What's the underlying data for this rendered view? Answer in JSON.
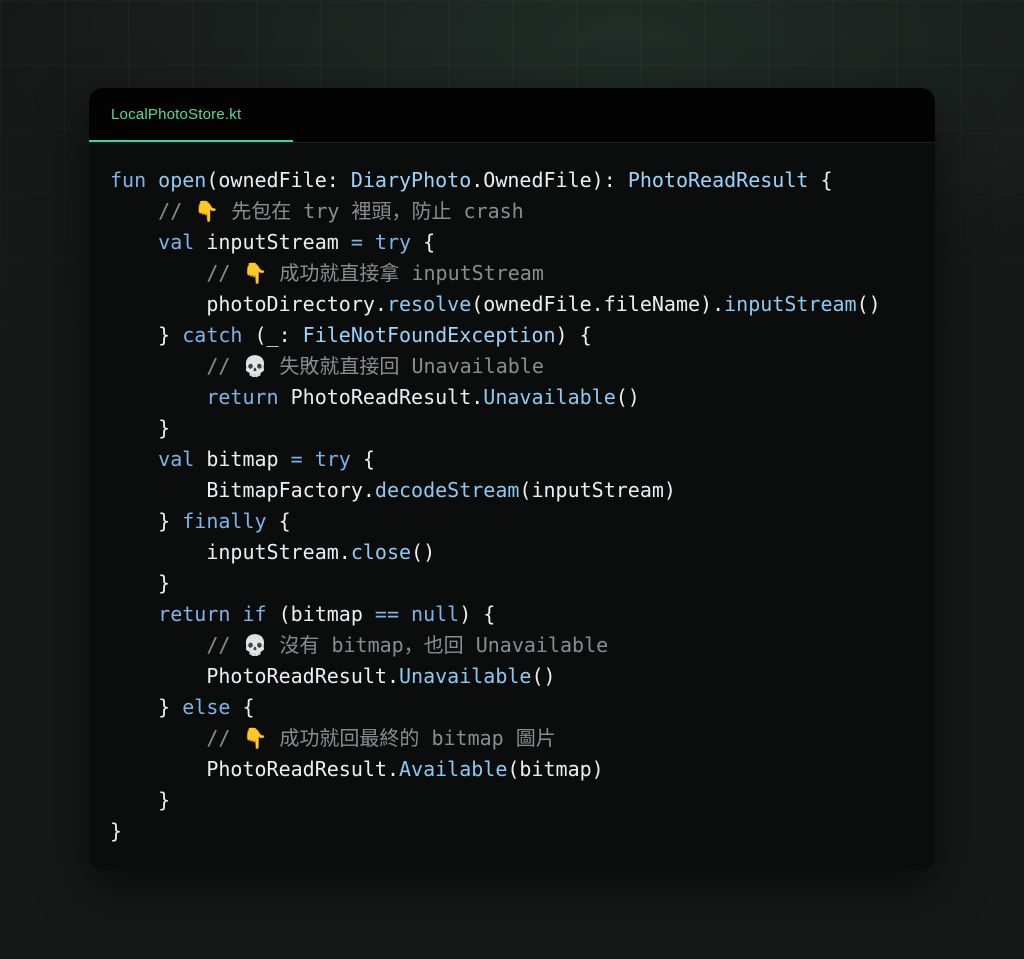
{
  "editor": {
    "tab_label": "LocalPhotoStore.kt",
    "lines": [
      [
        [
          "kw",
          "fun "
        ],
        [
          "fn",
          "open"
        ],
        [
          "pl",
          "(ownedFile: "
        ],
        [
          "ty",
          "DiaryPhoto"
        ],
        [
          "pl",
          ".OwnedFile): "
        ],
        [
          "ty",
          "PhotoReadResult"
        ],
        [
          "pl",
          " {"
        ]
      ],
      [
        [
          "pl",
          "    "
        ],
        [
          "cm",
          "// "
        ],
        [
          "em",
          "👇"
        ],
        [
          "cm",
          " 先包在 try 裡頭，防止 crash"
        ]
      ],
      [
        [
          "pl",
          "    "
        ],
        [
          "kw",
          "val "
        ],
        [
          "pl",
          "inputStream "
        ],
        [
          "kw",
          "= try "
        ],
        [
          "pl",
          "{"
        ]
      ],
      [
        [
          "pl",
          "        "
        ],
        [
          "cm",
          "// "
        ],
        [
          "em",
          "👇"
        ],
        [
          "cm",
          " 成功就直接拿 inputStream"
        ]
      ],
      [
        [
          "pl",
          "        photoDirectory."
        ],
        [
          "fn",
          "resolve"
        ],
        [
          "pl",
          "(ownedFile.fileName)."
        ],
        [
          "fn",
          "inputStream"
        ],
        [
          "pl",
          "()"
        ]
      ],
      [
        [
          "pl",
          "    } "
        ],
        [
          "kw",
          "catch "
        ],
        [
          "pl",
          "(_: "
        ],
        [
          "ty",
          "FileNotFoundException"
        ],
        [
          "pl",
          ") {"
        ]
      ],
      [
        [
          "pl",
          "        "
        ],
        [
          "cm",
          "// "
        ],
        [
          "sk",
          "💀"
        ],
        [
          "cm",
          " 失敗就直接回 Unavailable"
        ]
      ],
      [
        [
          "pl",
          "        "
        ],
        [
          "kw",
          "return "
        ],
        [
          "pl",
          "PhotoReadResult."
        ],
        [
          "fn",
          "Unavailable"
        ],
        [
          "pl",
          "()"
        ]
      ],
      [
        [
          "pl",
          "    }"
        ]
      ],
      [
        [
          "pl",
          "    "
        ],
        [
          "kw",
          "val "
        ],
        [
          "pl",
          "bitmap "
        ],
        [
          "kw",
          "= try "
        ],
        [
          "pl",
          "{"
        ]
      ],
      [
        [
          "pl",
          "        BitmapFactory."
        ],
        [
          "fn",
          "decodeStream"
        ],
        [
          "pl",
          "(inputStream)"
        ]
      ],
      [
        [
          "pl",
          "    } "
        ],
        [
          "kw",
          "finally "
        ],
        [
          "pl",
          "{"
        ]
      ],
      [
        [
          "pl",
          "        inputStream."
        ],
        [
          "fn",
          "close"
        ],
        [
          "pl",
          "()"
        ]
      ],
      [
        [
          "pl",
          "    }"
        ]
      ],
      [
        [
          "pl",
          "    "
        ],
        [
          "kw",
          "return if "
        ],
        [
          "pl",
          "(bitmap "
        ],
        [
          "kw",
          "== null"
        ],
        [
          "pl",
          ") {"
        ]
      ],
      [
        [
          "pl",
          "        "
        ],
        [
          "cm",
          "// "
        ],
        [
          "sk",
          "💀"
        ],
        [
          "cm",
          " 沒有 bitmap，也回 Unavailable"
        ]
      ],
      [
        [
          "pl",
          "        PhotoReadResult."
        ],
        [
          "fn",
          "Unavailable"
        ],
        [
          "pl",
          "()"
        ]
      ],
      [
        [
          "pl",
          "    } "
        ],
        [
          "kw",
          "else "
        ],
        [
          "pl",
          "{"
        ]
      ],
      [
        [
          "pl",
          "        "
        ],
        [
          "cm",
          "// "
        ],
        [
          "em",
          "👇"
        ],
        [
          "cm",
          " 成功就回最終的 bitmap 圖片"
        ]
      ],
      [
        [
          "pl",
          "        PhotoReadResult."
        ],
        [
          "fn",
          "Available"
        ],
        [
          "pl",
          "(bitmap)"
        ]
      ],
      [
        [
          "pl",
          "    }"
        ]
      ],
      [
        [
          "pl",
          "}"
        ]
      ]
    ]
  },
  "colors": {
    "keyword": "#7eb3e8",
    "function": "#8ccaf3",
    "type": "#9dd4fb",
    "comment": "#8a8d90",
    "plain": "#eceff1",
    "tab_accent": "#3fd29a"
  }
}
